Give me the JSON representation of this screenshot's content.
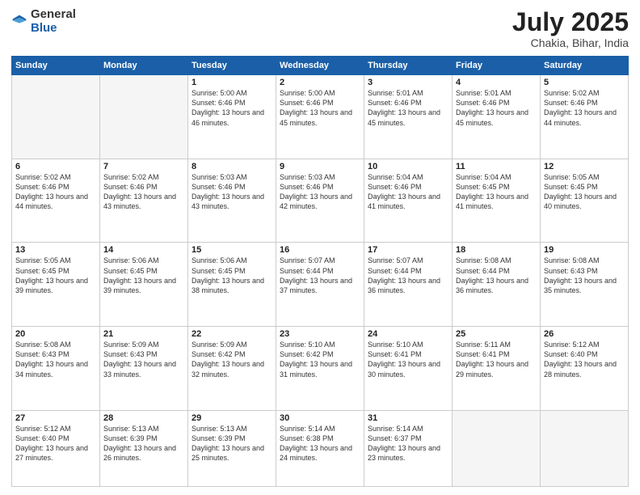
{
  "header": {
    "logo_general": "General",
    "logo_blue": "Blue",
    "title": "July 2025",
    "location": "Chakia, Bihar, India"
  },
  "days_of_week": [
    "Sunday",
    "Monday",
    "Tuesday",
    "Wednesday",
    "Thursday",
    "Friday",
    "Saturday"
  ],
  "weeks": [
    [
      {
        "day": "",
        "info": ""
      },
      {
        "day": "",
        "info": ""
      },
      {
        "day": "1",
        "info": "Sunrise: 5:00 AM\nSunset: 6:46 PM\nDaylight: 13 hours and 46 minutes."
      },
      {
        "day": "2",
        "info": "Sunrise: 5:00 AM\nSunset: 6:46 PM\nDaylight: 13 hours and 45 minutes."
      },
      {
        "day": "3",
        "info": "Sunrise: 5:01 AM\nSunset: 6:46 PM\nDaylight: 13 hours and 45 minutes."
      },
      {
        "day": "4",
        "info": "Sunrise: 5:01 AM\nSunset: 6:46 PM\nDaylight: 13 hours and 45 minutes."
      },
      {
        "day": "5",
        "info": "Sunrise: 5:02 AM\nSunset: 6:46 PM\nDaylight: 13 hours and 44 minutes."
      }
    ],
    [
      {
        "day": "6",
        "info": "Sunrise: 5:02 AM\nSunset: 6:46 PM\nDaylight: 13 hours and 44 minutes."
      },
      {
        "day": "7",
        "info": "Sunrise: 5:02 AM\nSunset: 6:46 PM\nDaylight: 13 hours and 43 minutes."
      },
      {
        "day": "8",
        "info": "Sunrise: 5:03 AM\nSunset: 6:46 PM\nDaylight: 13 hours and 43 minutes."
      },
      {
        "day": "9",
        "info": "Sunrise: 5:03 AM\nSunset: 6:46 PM\nDaylight: 13 hours and 42 minutes."
      },
      {
        "day": "10",
        "info": "Sunrise: 5:04 AM\nSunset: 6:46 PM\nDaylight: 13 hours and 41 minutes."
      },
      {
        "day": "11",
        "info": "Sunrise: 5:04 AM\nSunset: 6:45 PM\nDaylight: 13 hours and 41 minutes."
      },
      {
        "day": "12",
        "info": "Sunrise: 5:05 AM\nSunset: 6:45 PM\nDaylight: 13 hours and 40 minutes."
      }
    ],
    [
      {
        "day": "13",
        "info": "Sunrise: 5:05 AM\nSunset: 6:45 PM\nDaylight: 13 hours and 39 minutes."
      },
      {
        "day": "14",
        "info": "Sunrise: 5:06 AM\nSunset: 6:45 PM\nDaylight: 13 hours and 39 minutes."
      },
      {
        "day": "15",
        "info": "Sunrise: 5:06 AM\nSunset: 6:45 PM\nDaylight: 13 hours and 38 minutes."
      },
      {
        "day": "16",
        "info": "Sunrise: 5:07 AM\nSunset: 6:44 PM\nDaylight: 13 hours and 37 minutes."
      },
      {
        "day": "17",
        "info": "Sunrise: 5:07 AM\nSunset: 6:44 PM\nDaylight: 13 hours and 36 minutes."
      },
      {
        "day": "18",
        "info": "Sunrise: 5:08 AM\nSunset: 6:44 PM\nDaylight: 13 hours and 36 minutes."
      },
      {
        "day": "19",
        "info": "Sunrise: 5:08 AM\nSunset: 6:43 PM\nDaylight: 13 hours and 35 minutes."
      }
    ],
    [
      {
        "day": "20",
        "info": "Sunrise: 5:08 AM\nSunset: 6:43 PM\nDaylight: 13 hours and 34 minutes."
      },
      {
        "day": "21",
        "info": "Sunrise: 5:09 AM\nSunset: 6:43 PM\nDaylight: 13 hours and 33 minutes."
      },
      {
        "day": "22",
        "info": "Sunrise: 5:09 AM\nSunset: 6:42 PM\nDaylight: 13 hours and 32 minutes."
      },
      {
        "day": "23",
        "info": "Sunrise: 5:10 AM\nSunset: 6:42 PM\nDaylight: 13 hours and 31 minutes."
      },
      {
        "day": "24",
        "info": "Sunrise: 5:10 AM\nSunset: 6:41 PM\nDaylight: 13 hours and 30 minutes."
      },
      {
        "day": "25",
        "info": "Sunrise: 5:11 AM\nSunset: 6:41 PM\nDaylight: 13 hours and 29 minutes."
      },
      {
        "day": "26",
        "info": "Sunrise: 5:12 AM\nSunset: 6:40 PM\nDaylight: 13 hours and 28 minutes."
      }
    ],
    [
      {
        "day": "27",
        "info": "Sunrise: 5:12 AM\nSunset: 6:40 PM\nDaylight: 13 hours and 27 minutes."
      },
      {
        "day": "28",
        "info": "Sunrise: 5:13 AM\nSunset: 6:39 PM\nDaylight: 13 hours and 26 minutes."
      },
      {
        "day": "29",
        "info": "Sunrise: 5:13 AM\nSunset: 6:39 PM\nDaylight: 13 hours and 25 minutes."
      },
      {
        "day": "30",
        "info": "Sunrise: 5:14 AM\nSunset: 6:38 PM\nDaylight: 13 hours and 24 minutes."
      },
      {
        "day": "31",
        "info": "Sunrise: 5:14 AM\nSunset: 6:37 PM\nDaylight: 13 hours and 23 minutes."
      },
      {
        "day": "",
        "info": ""
      },
      {
        "day": "",
        "info": ""
      }
    ]
  ]
}
